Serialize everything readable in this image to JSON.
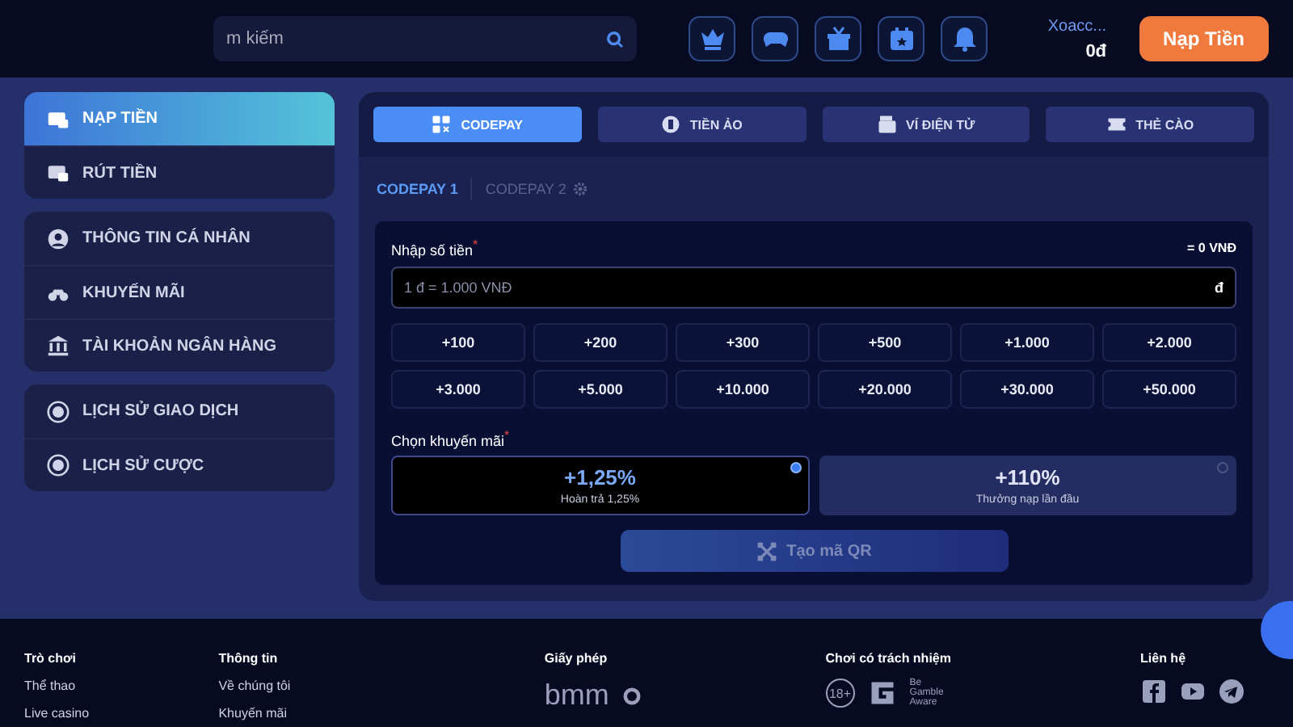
{
  "header": {
    "search": {
      "placeholder": "m kiếm"
    },
    "user": {
      "name": "Xoacc...",
      "balance": "0đ"
    },
    "deposit_button": "Nạp Tiền"
  },
  "sidebar": {
    "groups": [
      {
        "items": [
          {
            "label": "NẠP TIỀN",
            "selected": true
          },
          {
            "label": "RÚT TIỀN",
            "selected": false
          }
        ]
      },
      {
        "items": [
          {
            "label": "THÔNG TIN CÁ NHÂN",
            "selected": false
          },
          {
            "label": "KHUYẾN MÃI",
            "selected": false
          },
          {
            "label": "TÀI KHOẢN NGÂN HÀNG",
            "selected": false
          }
        ]
      },
      {
        "items": [
          {
            "label": "LỊCH SỬ GIAO DỊCH",
            "selected": false
          },
          {
            "label": "LỊCH SỬ CƯỢC",
            "selected": false
          }
        ]
      }
    ]
  },
  "tabs": [
    {
      "label": "CODEPAY",
      "selected": true
    },
    {
      "label": "TIỀN ẢO",
      "selected": false
    },
    {
      "label": "VÍ ĐIỆN TỬ",
      "selected": false
    },
    {
      "label": "THẺ CÀO",
      "selected": false
    }
  ],
  "subtabs": [
    {
      "label": "CODEPAY 1",
      "selected": true,
      "disabled": false
    },
    {
      "label": "CODEPAY 2",
      "selected": false,
      "disabled": true
    }
  ],
  "amount": {
    "label": "Nhập số tiền",
    "required_mark": "*",
    "converted": "= 0 VNĐ",
    "placeholder": "1 đ = 1.000 VNĐ",
    "suffix": "đ"
  },
  "chips": [
    "+100",
    "+200",
    "+300",
    "+500",
    "+1.000",
    "+2.000",
    "+3.000",
    "+5.000",
    "+10.000",
    "+20.000",
    "+30.000",
    "+50.000"
  ],
  "promotion": {
    "label": "Chọn khuyến mãi",
    "required_mark": "*",
    "options": [
      {
        "value": "+1,25%",
        "caption": "Hoàn trả 1,25%",
        "selected": true
      },
      {
        "value": "+110%",
        "caption": "Thưởng nạp lần đầu",
        "selected": false
      }
    ]
  },
  "qr_button": {
    "label": "Tạo mã QR",
    "disabled": true
  },
  "footer": {
    "columns": [
      {
        "title": "Trò chơi",
        "links": [
          "Thể thao",
          "Live casino"
        ]
      },
      {
        "title": "Thông tin",
        "links": [
          "Về chúng tôi",
          "Khuyến mãi"
        ]
      },
      {
        "title": "Giấy phép",
        "kind": "license",
        "logo": "bmm"
      },
      {
        "title": "Chơi có trách nhiệm",
        "kind": "responsible",
        "age": "18+",
        "aware": "Be Gamble Aware"
      },
      {
        "title": "Liên hệ",
        "kind": "social"
      }
    ]
  }
}
